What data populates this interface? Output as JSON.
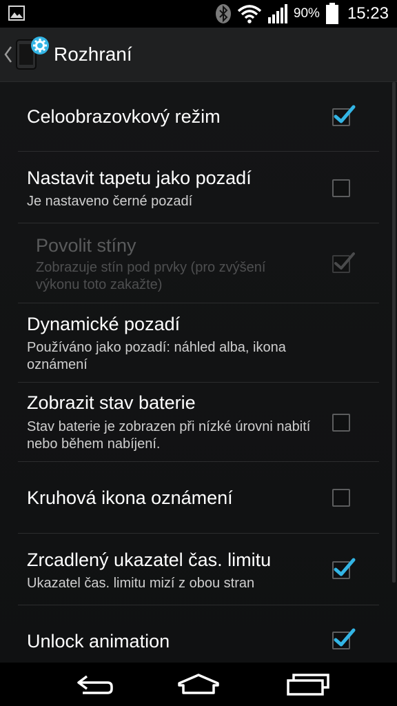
{
  "status_bar": {
    "battery_percent": "90%",
    "time": "15:23",
    "icons": [
      "gallery-icon",
      "bluetooth-icon",
      "wifi-icon",
      "signal-icon",
      "battery-icon"
    ]
  },
  "action_bar": {
    "title": "Rozhraní",
    "back_icon": "chevron-left-icon",
    "app_icon": "settings-app-icon"
  },
  "settings": [
    {
      "title": "Celoobrazovkový režim",
      "summary": "",
      "checked": true,
      "enabled": true
    },
    {
      "title": "Nastavit tapetu jako pozadí",
      "summary": "Je nastaveno černé pozadí",
      "checked": false,
      "enabled": true
    },
    {
      "title": "Povolit stíny",
      "summary": "Zobrazuje stín pod prvky (pro zvýšení výkonu toto zakažte)",
      "checked": true,
      "enabled": false
    },
    {
      "title": "Dynamické pozadí",
      "summary": "Používáno jako pozadí: náhled alba, ikona oznámení",
      "checked": null,
      "enabled": true
    },
    {
      "title": "Zobrazit stav baterie",
      "summary": "Stav baterie je zobrazen při nízké úrovni nabití nebo během nabíjení.",
      "checked": false,
      "enabled": true
    },
    {
      "title": "Kruhová ikona oznámení",
      "summary": "",
      "checked": false,
      "enabled": true
    },
    {
      "title": "Zrcadlený ukazatel čas. limitu",
      "summary": "Ukazatel čas. limitu mizí z obou stran",
      "checked": true,
      "enabled": true
    },
    {
      "title": "Unlock animation",
      "summary": "",
      "checked": true,
      "enabled": true
    }
  ],
  "nav_bar": {
    "icons": [
      "back-icon",
      "home-icon",
      "recent-apps-icon"
    ]
  },
  "colors": {
    "accent": "#33b5e5",
    "background": "#121314",
    "action_bar": "#1f2021",
    "disabled_text": "#5a5b5c"
  }
}
